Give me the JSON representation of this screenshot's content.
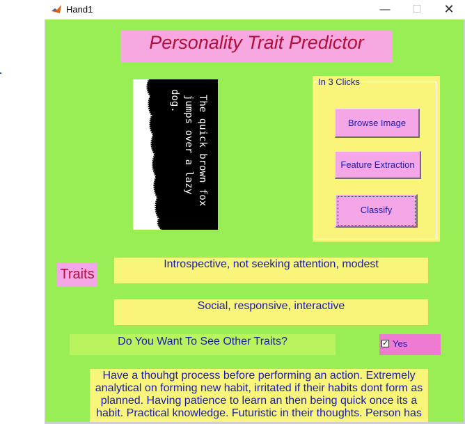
{
  "window": {
    "title": "Hand1",
    "minimize_glyph": "—",
    "maximize_glyph": "☐",
    "close_glyph": "✕",
    "icon": "matlab-icon"
  },
  "app": {
    "title": "Personality Trait Predictor",
    "colors": {
      "background": "#99ee55",
      "pink": "#f5a6e6",
      "yellow": "#f8f57a",
      "title_text": "#b0103c",
      "body_text": "#1a1ab0"
    }
  },
  "handwriting_image": {
    "lines": [
      "The quick brown fox",
      "jumps over a lazy",
      "dog."
    ]
  },
  "clicks_panel": {
    "legend": "In 3 Clicks",
    "buttons": {
      "browse": "Browse Image",
      "feature": "Feature Extraction",
      "classify": "Classify"
    }
  },
  "traits": {
    "label": "Traits",
    "trait1": "Introspective, not seeking attention, modest",
    "trait2": "Social, responsive, interactive"
  },
  "other_traits": {
    "question": "Do You Want To See Other Traits?",
    "checkbox_label": "Yes",
    "checked": true,
    "description": "Have a thouhgt process before performing an action. Extremely analytical on forming new habit, irritated if their habits dont form as planned. Having patience to learn an then being quick once its a habit. Practical knowledge. Futuristic in their thoughts. Person has"
  }
}
